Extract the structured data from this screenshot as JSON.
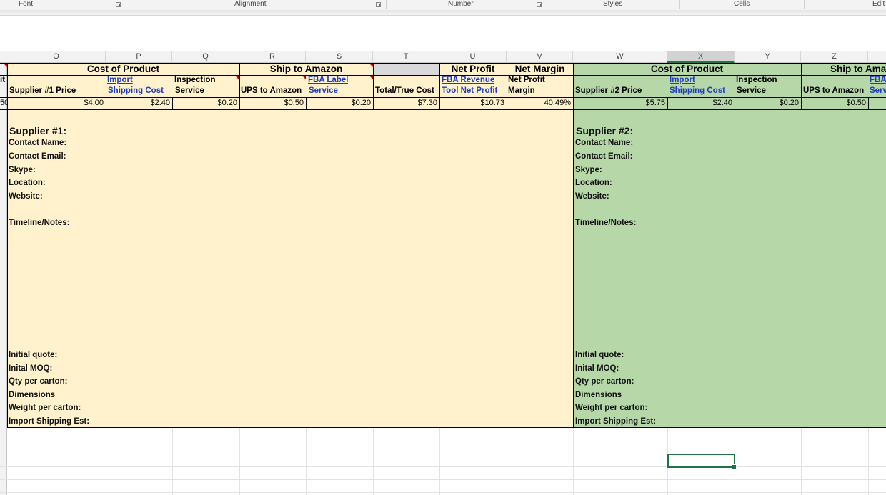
{
  "ribbon": {
    "groups": [
      "Font",
      "Alignment",
      "Number",
      "Styles",
      "Cells",
      "Edit"
    ]
  },
  "columns": [
    "O",
    "P",
    "Q",
    "R",
    "S",
    "T",
    "U",
    "V",
    "W",
    "X",
    "Y",
    "Z"
  ],
  "selected_column": "X",
  "left_header_partial": "it",
  "left_value_partial": "50",
  "section1": {
    "cost_of_product": "Cost of Product",
    "ship_to_amazon": "Ship to Amazon",
    "net_profit": "Net Profit",
    "net_margin": "Net Margin",
    "supplier_price": "Supplier #1 Price",
    "import_line1": "Import",
    "import_line2": "Shipping Cost",
    "inspection_line1": "Inspection",
    "inspection_line2": "Service",
    "ups_to_amazon": "UPS to Amazon",
    "fba_label_line1": "FBA Label",
    "fba_label_line2": "Service",
    "total_true_cost": "Total/True Cost",
    "fba_revenue_line1": "FBA Revenue",
    "fba_revenue_line2": "Tool Net Profit",
    "net_profit_margin_line1": "Net Profit",
    "net_profit_margin_line2": "Margin",
    "values": {
      "supplier_price": "$4.00",
      "import_shipping": "$2.40",
      "inspection": "$0.20",
      "ups": "$0.50",
      "fba_label": "$0.20",
      "total": "$7.30",
      "net_profit": "$10.73",
      "margin": "40.49%"
    },
    "details": {
      "title": "Supplier #1:",
      "contact_name": "Contact Name:",
      "contact_email": "Contact Email:",
      "skype": "Skype:",
      "location": "Location:",
      "website": "Website:",
      "timeline": "Timeline/Notes:",
      "initial_quote": "Initial quote:",
      "moq": "Inital MOQ:",
      "qty_per_carton": "Qty per carton:",
      "dimensions": "Dimensions",
      "weight": "Weight per carton:",
      "import_shipping_est": "Import Shipping Est:"
    }
  },
  "section2": {
    "cost_of_product": "Cost of Product",
    "ship_to_amazon": "Ship to Ama",
    "supplier_price": "Supplier #2 Price",
    "import_line1": "Import",
    "import_line2": "Shipping Cost",
    "inspection_line1": "Inspection",
    "inspection_line2": "Service",
    "ups_to_amazon": "UPS to Amazon",
    "fba_partial_line1": "FBA",
    "fba_partial_line2": "Serv",
    "values": {
      "supplier_price": "$5.75",
      "import_shipping": "$2.40",
      "inspection": "$0.20",
      "ups": "$0.50"
    },
    "details": {
      "title": "Supplier #2:",
      "contact_name": "Contact Name:",
      "contact_email": "Contact Email:",
      "skype": "Skype:",
      "location": "Location:",
      "website": "Website:",
      "timeline": "Timeline/Notes:",
      "initial_quote": "Initial quote:",
      "moq": "Inital MOQ:",
      "qty_per_carton": "Qty per carton:",
      "dimensions": "Dimensions",
      "weight": "Weight per carton:",
      "import_shipping_est": "Import Shipping Est:"
    }
  },
  "colors": {
    "section1_fill": "#fff2cc",
    "section2_fill": "#b6d7a8",
    "link": "#1f3fbf",
    "selection": "#217346"
  }
}
